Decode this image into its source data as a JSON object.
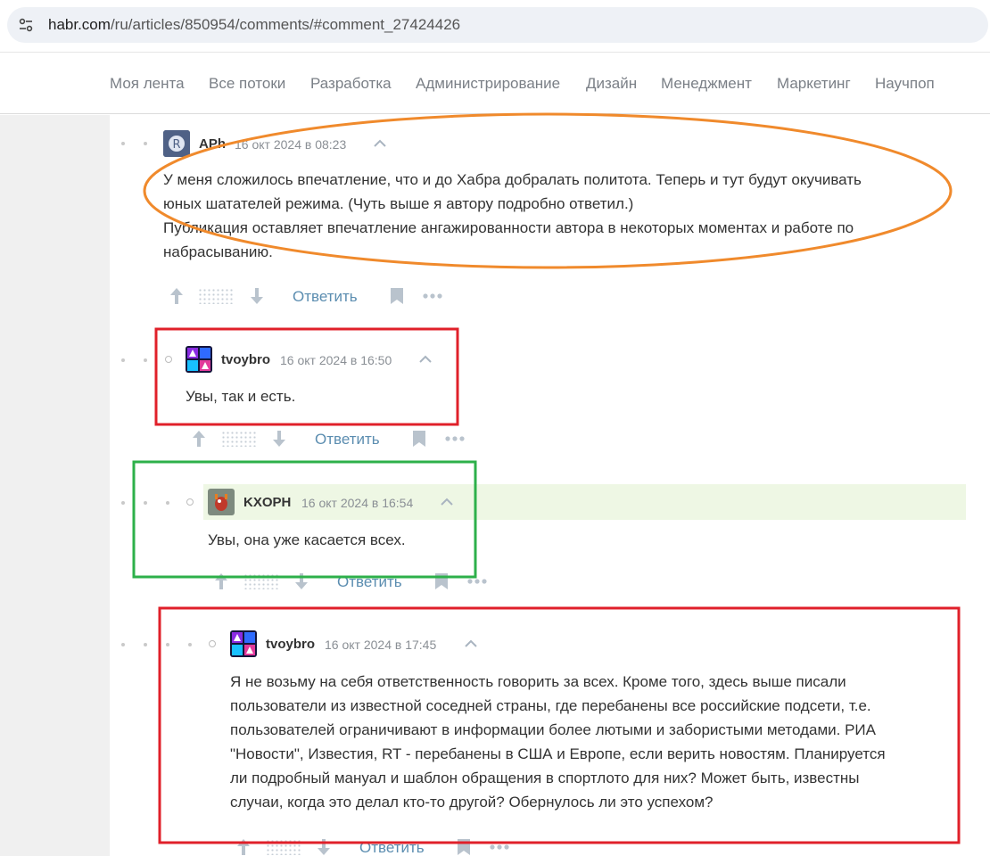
{
  "browser": {
    "url_host": "habr.com",
    "url_path": "/ru/articles/850954/comments/#comment_27424426"
  },
  "nav": {
    "items": [
      "Моя лента",
      "Все потоки",
      "Разработка",
      "Администрирование",
      "Дизайн",
      "Менеджмент",
      "Маркетинг",
      "Научпоп"
    ]
  },
  "comments": [
    {
      "username": "APh",
      "timestamp": "16 окт 2024 в 08:23",
      "lines": [
        "У меня сложилось впечатление, что и до Хабра добралать политота. Теперь и тут будут окучивать",
        "юных шатателей режима. (Чуть выше я автору подробно ответил.)",
        "Публикация оставляет впечатление ангажированности автора в некоторых моментах и работе по",
        "набрасыванию."
      ],
      "reply_label": "Ответить"
    },
    {
      "username": "tvoybro",
      "timestamp": "16 окт 2024 в 16:50",
      "lines": [
        "Увы, так и есть."
      ],
      "reply_label": "Ответить"
    },
    {
      "username": "KXOPH",
      "timestamp": "16 окт 2024 в 16:54",
      "lines": [
        "Увы, она уже касается всех."
      ],
      "reply_label": "Ответить"
    },
    {
      "username": "tvoybro",
      "timestamp": "16 окт 2024 в 17:45",
      "lines": [
        "Я не возьму на себя ответственность говорить за всех. Кроме того, здесь выше писали",
        "пользователи из известной соседней страны, где перебанены все российские подсети, т.е.",
        "пользователей ограничивают в информации более лютыми и забористыми методами. РИА",
        "\"Новости\", Известия, RT - перебанены в США и Европе, если верить новостям. Планируется",
        "ли подробный мануал и шаблон обращения в спортлото для них? Может быть, известны",
        "случаи, когда это делал кто-то другой? Обернулось ли это успехом?"
      ],
      "reply_label": "Ответить"
    }
  ],
  "colors": {
    "annotation_orange": "#f08a2c",
    "annotation_red": "#e0202a",
    "annotation_green": "#2db04a",
    "highlight_bg": "#eef7e4",
    "link": "#5b8db0"
  }
}
